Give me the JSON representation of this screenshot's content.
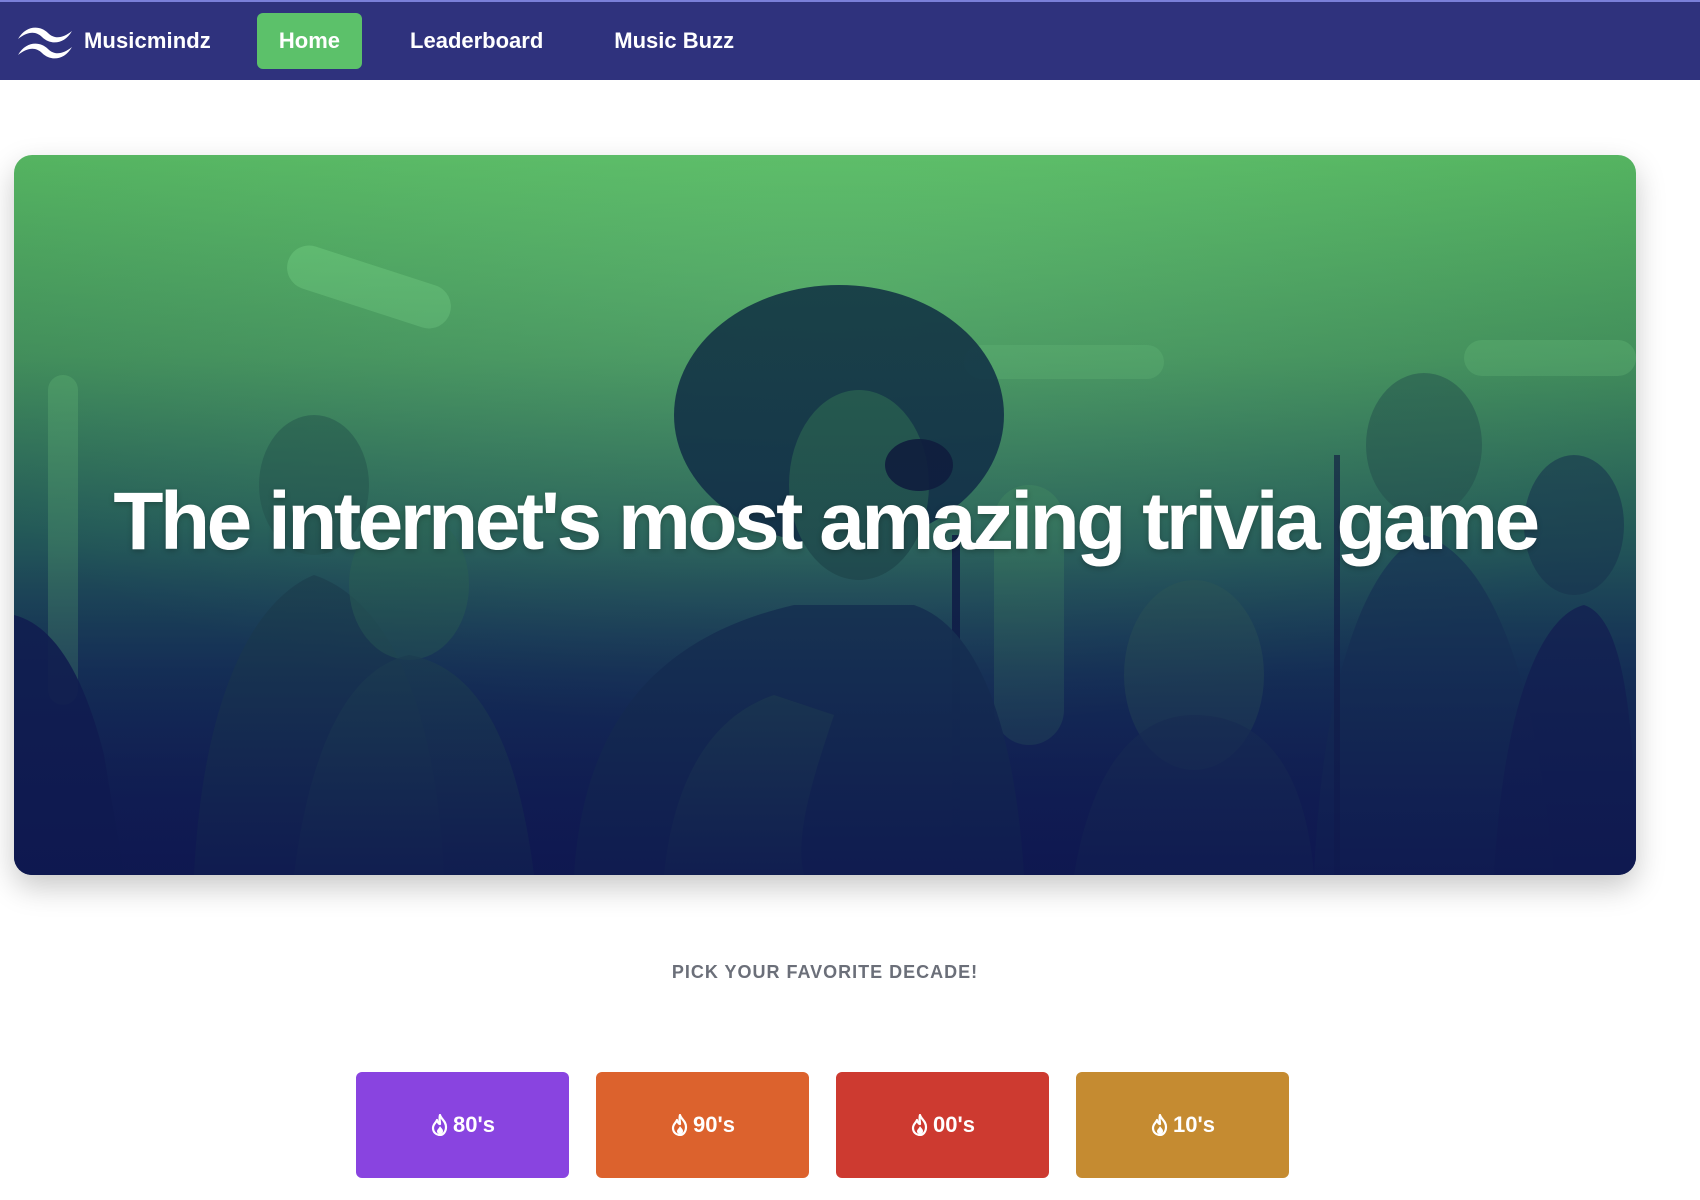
{
  "brand": {
    "name": "Musicmindz",
    "logo_icon": "wave-logo-icon"
  },
  "nav": {
    "items": [
      {
        "label": "Home",
        "active": true
      },
      {
        "label": "Leaderboard",
        "active": false
      },
      {
        "label": "Music Buzz",
        "active": false
      }
    ]
  },
  "hero": {
    "title": "The internet's most amazing trivia game"
  },
  "decades": {
    "label": "PICK YOUR FAVORITE DECADE!",
    "options": [
      {
        "label": "80's",
        "color": "#8944e0",
        "icon": "fire-icon"
      },
      {
        "label": "90's",
        "color": "#dc622d",
        "icon": "fire-icon"
      },
      {
        "label": "00's",
        "color": "#cd3a30",
        "icon": "fire-icon"
      },
      {
        "label": "10's",
        "color": "#c58b31",
        "icon": "fire-icon"
      }
    ]
  },
  "colors": {
    "navbar": "#2f327d",
    "active_tab": "#5cc16a",
    "hero_top": "#53b25f",
    "hero_bottom": "#141e55",
    "label_text": "#6b6f79"
  }
}
